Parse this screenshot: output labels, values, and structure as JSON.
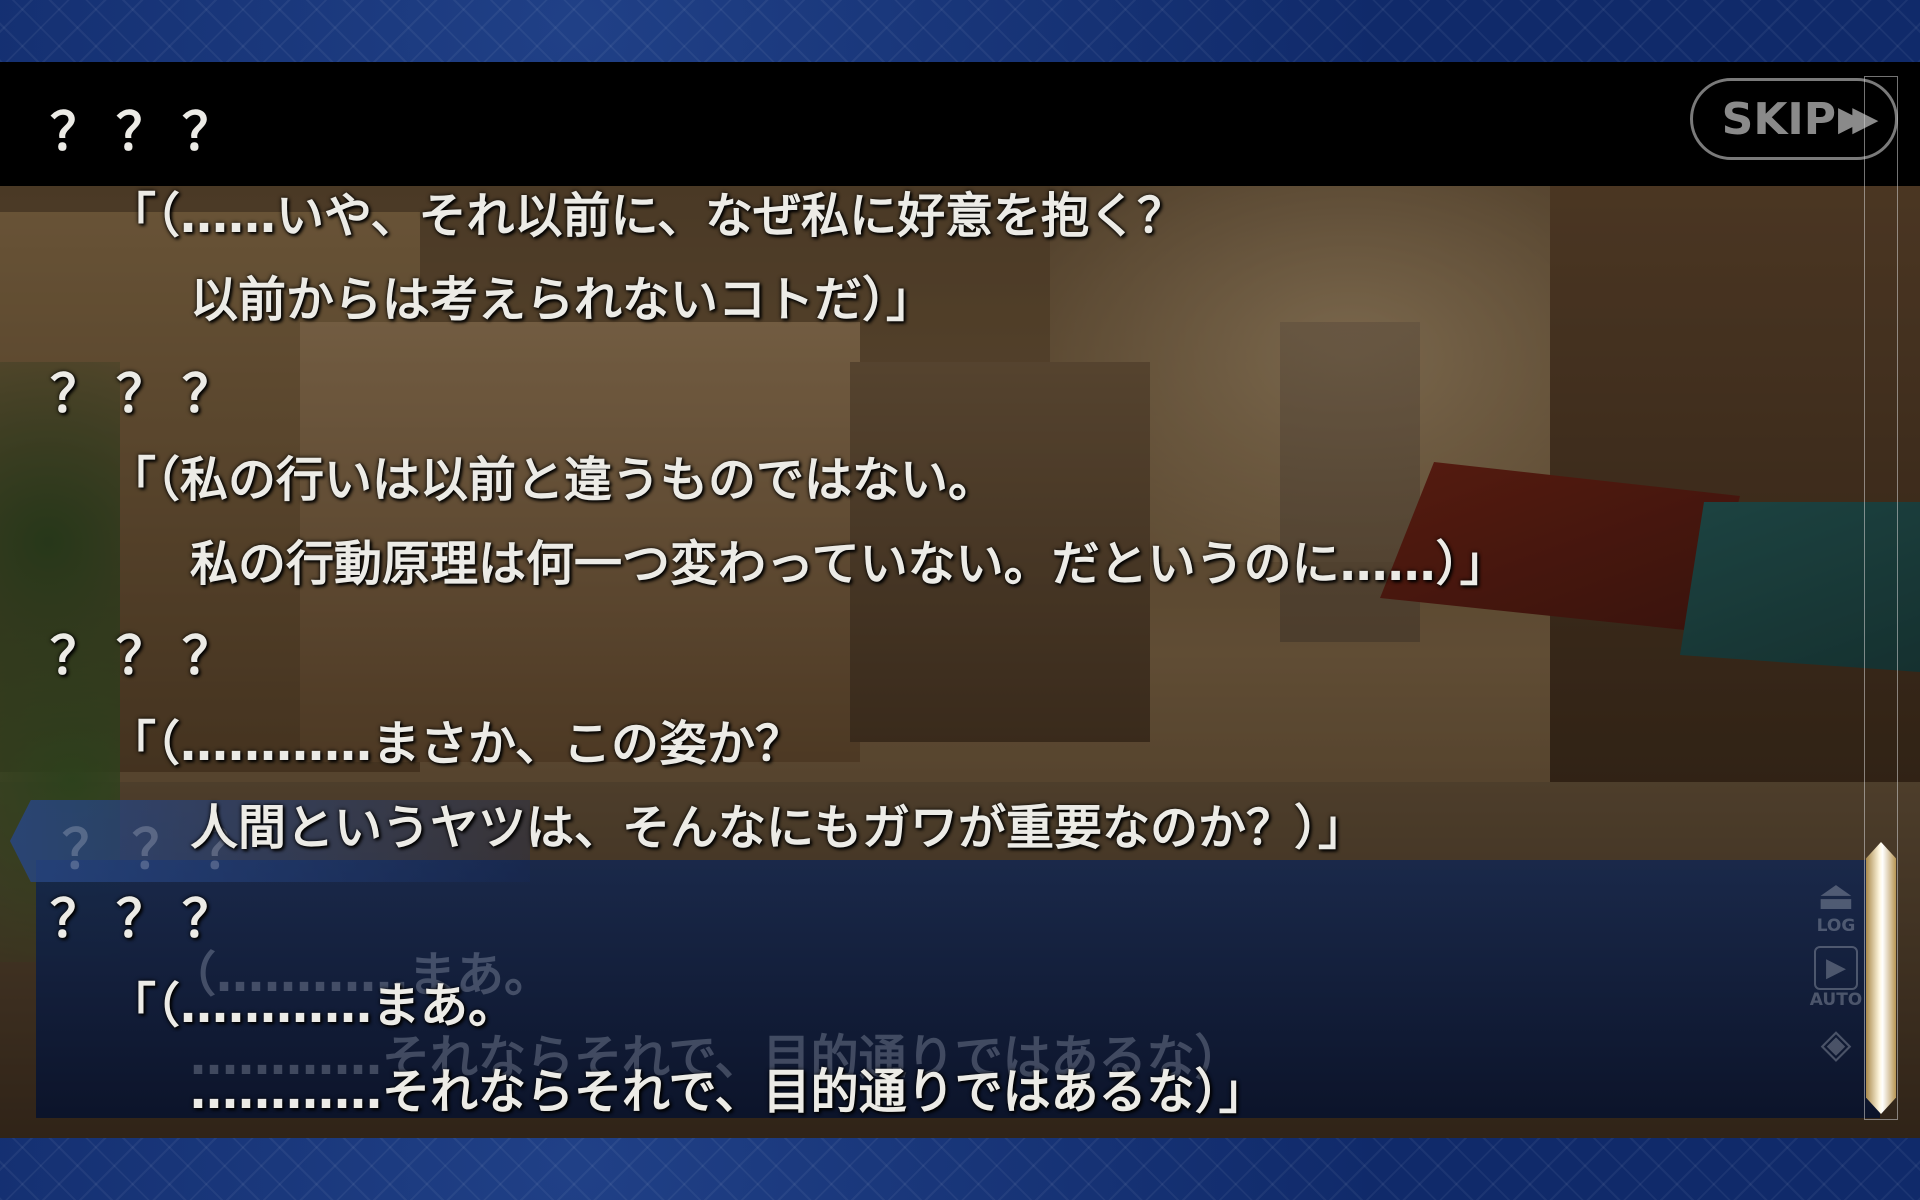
{
  "top_controls": {
    "skip_label": "SKIP",
    "skip_icon": "fast-forward-icon"
  },
  "log": [
    {
      "speaker": "？？？",
      "lines": [
        "「（……いや、それ以前に、なぜ私に好意を抱く？",
        "以前からは考えられないコトだ）」"
      ]
    },
    {
      "speaker": "？？？",
      "lines": [
        "「（私の行いは以前と違うものではない。",
        "私の行動原理は何一つ変わっていない。だというのに……）」"
      ]
    },
    {
      "speaker": "？？？",
      "lines": [
        "「（…………まさか、この姿か？",
        "人間というヤツは、そんなにもガワが重要なのか？）」"
      ]
    },
    {
      "speaker": "？？？",
      "lines": [
        "「（…………まあ。",
        "…………それならそれで、目的通りではあるな）」"
      ]
    }
  ],
  "dialog_underlay": {
    "name": "？？？",
    "line1": "（…………まあ。",
    "line2": "…………それならそれで、目的通りではあるな）"
  },
  "side_menu": {
    "log_label": "LOG",
    "log_icon": "eject-icon",
    "auto_label": "AUTO",
    "auto_icon": "play-icon",
    "menu_icon": "diamond-icon"
  },
  "scrollbar": {
    "position": 0.95
  }
}
